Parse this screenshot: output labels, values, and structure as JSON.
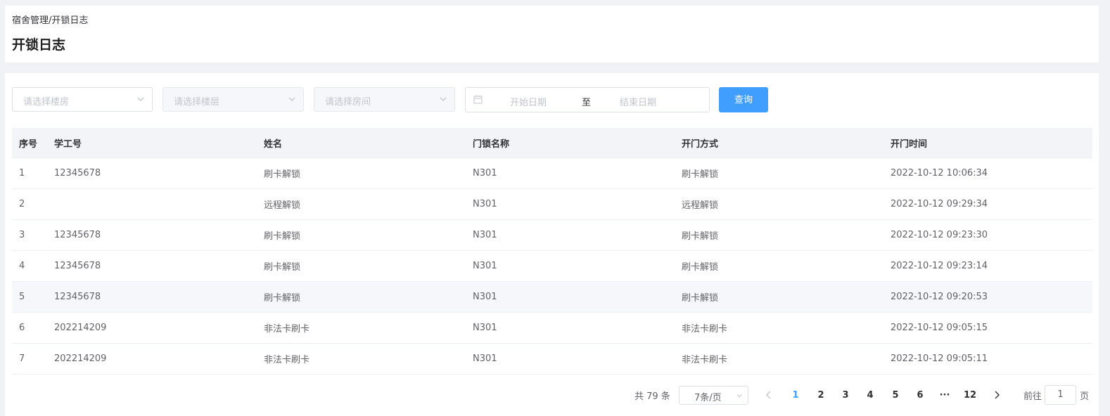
{
  "header": {
    "breadcrumb": "宿舍管理/开锁日志",
    "title": "开锁日志"
  },
  "filters": {
    "building_placeholder": "请选择楼房",
    "floor_placeholder": "请选择楼层",
    "room_placeholder": "请选择房间",
    "start_date_placeholder": "开始日期",
    "range_separator": "至",
    "end_date_placeholder": "结束日期",
    "query_label": "查询"
  },
  "table": {
    "columns": [
      "序号",
      "学工号",
      "姓名",
      "门锁名称",
      "开门方式",
      "开门时间"
    ],
    "rows": [
      [
        "1",
        "12345678",
        "刷卡解锁",
        "N301",
        "刷卡解锁",
        "2022-10-12 10:06:34"
      ],
      [
        "2",
        "",
        "远程解锁",
        "N301",
        "远程解锁",
        "2022-10-12 09:29:34"
      ],
      [
        "3",
        "12345678",
        "刷卡解锁",
        "N301",
        "刷卡解锁",
        "2022-10-12 09:23:30"
      ],
      [
        "4",
        "12345678",
        "刷卡解锁",
        "N301",
        "刷卡解锁",
        "2022-10-12 09:23:14"
      ],
      [
        "5",
        "12345678",
        "刷卡解锁",
        "N301",
        "刷卡解锁",
        "2022-10-12 09:20:53"
      ],
      [
        "6",
        "202214209",
        "非法卡刷卡",
        "N301",
        "非法卡刷卡",
        "2022-10-12 09:05:15"
      ],
      [
        "7",
        "202214209",
        "非法卡刷卡",
        "N301",
        "非法卡刷卡",
        "2022-10-12 09:05:11"
      ]
    ]
  },
  "pagination": {
    "total": "共 79 条",
    "page_size": "7条/页",
    "pages": [
      "1",
      "2",
      "3",
      "4",
      "5",
      "6",
      "···",
      "12"
    ],
    "current": "1",
    "goto_label": "前往",
    "goto_value": "1",
    "goto_unit": "页"
  },
  "colors": {
    "primary": "#409eff",
    "header_bg": "#f2f4f8"
  }
}
